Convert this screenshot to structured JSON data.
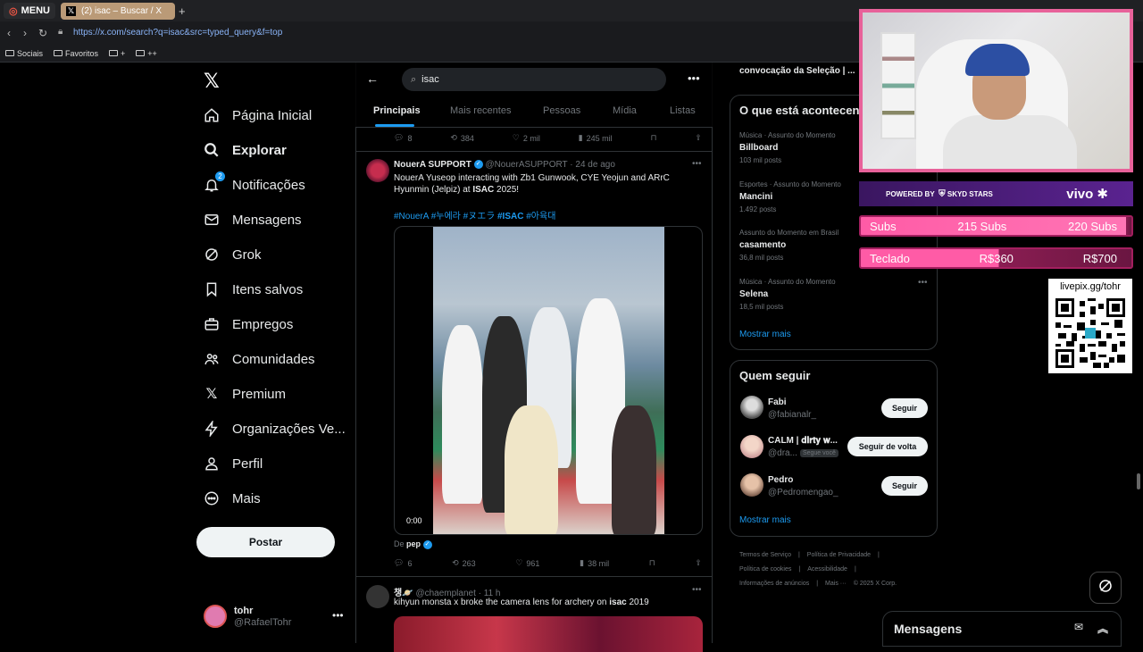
{
  "browser": {
    "menu_label": "MENU",
    "tab_title": "(2) isac – Buscar / X",
    "url": "https://x.com/search?q=isac&src=typed_query&f=top",
    "bookmarks": [
      "Sociais",
      "Favoritos",
      "+",
      "++"
    ]
  },
  "nav": {
    "items": [
      {
        "label": "Página Inicial",
        "icon": "home-icon"
      },
      {
        "label": "Explorar",
        "icon": "search-icon"
      },
      {
        "label": "Notificações",
        "icon": "bell-icon",
        "badge": "2"
      },
      {
        "label": "Mensagens",
        "icon": "mail-icon"
      },
      {
        "label": "Grok",
        "icon": "grok-icon"
      },
      {
        "label": "Itens salvos",
        "icon": "bookmark-icon"
      },
      {
        "label": "Empregos",
        "icon": "briefcase-icon"
      },
      {
        "label": "Comunidades",
        "icon": "people-icon"
      },
      {
        "label": "Premium",
        "icon": "x-icon"
      },
      {
        "label": "Organizações Ve...",
        "icon": "lightning-icon"
      },
      {
        "label": "Perfil",
        "icon": "person-icon"
      },
      {
        "label": "Mais",
        "icon": "more-circle-icon"
      }
    ],
    "post_label": "Postar",
    "user_name": "tohr",
    "user_handle": "@RafaelTohr"
  },
  "search": {
    "query": "isac",
    "tabs": [
      "Principais",
      "Mais recentes",
      "Pessoas",
      "Mídia",
      "Listas"
    ]
  },
  "prev_actions": {
    "replies": "8",
    "reposts": "384",
    "likes": "2 mil",
    "views": "245 mil"
  },
  "tweet1": {
    "name": "NouerA SUPPORT",
    "handle": "@NouerASUPPORT",
    "time": "24 de ago",
    "text_pre": "NouerA Yuseop interacting with Zb1 Gunwook, CYE Yeojun and ARrC Hyunmin (Jelpiz) at ",
    "text_bold": "ISAC",
    "text_post": " 2025!",
    "tag1": "#NouerA",
    "tag2": "#누에라",
    "tag3": "#ヌエラ",
    "tag4": "#ISAC",
    "tag5": "#아육대",
    "video_time": "0:00",
    "from_prefix": "De",
    "from_name": "pep",
    "replies": "6",
    "reposts": "263",
    "likes": "961",
    "views": "38 mil"
  },
  "tweet2": {
    "name": "챙🪐",
    "handle": "@chaemplanet",
    "time": "11 h",
    "text_pre": "kihyun monsta x broke the camera lens for archery on ",
    "text_bold": "isac",
    "text_post": " 2019"
  },
  "trends": {
    "top_item": "convocação da Seleção | ...",
    "title": "O que está acontecendo",
    "items": [
      {
        "meta": "Música · Assunto do Momento",
        "name": "Billboard",
        "count": "103 mil posts"
      },
      {
        "meta": "Esportes · Assunto do Momento",
        "name": "Mancini",
        "count": "1.492 posts"
      },
      {
        "meta": "Assunto do Momento em Brasil",
        "name": "casamento",
        "count": "36,8 mil posts"
      },
      {
        "meta": "Música · Assunto do Momento",
        "name": "Selena",
        "count": "18,5 mil posts"
      }
    ],
    "show_more": "Mostrar mais"
  },
  "follow": {
    "title": "Quem seguir",
    "users": [
      {
        "name": "Fabi",
        "handle": "@fabianalr_",
        "button": "Seguir"
      },
      {
        "name": "CALM | 𝐝𝐢𝐫𝐭𝐲 𝐰...",
        "handle": "@dra...",
        "follows_you": "Segue você",
        "button": "Seguir de volta"
      },
      {
        "name": "Pedro",
        "handle": "@Pedromengao_",
        "button": "Seguir"
      }
    ],
    "show_more": "Mostrar mais"
  },
  "footer": {
    "links": [
      "Termos de Serviço",
      "|",
      "Política de Privacidade",
      "|",
      "Política de cookies",
      "|",
      "Acessibilidade",
      "|",
      "Informações de anúncios",
      "|",
      "Mais ···",
      "© 2025 X Corp."
    ]
  },
  "overlay": {
    "powered_by": "POWERED BY",
    "sponsor1": "SKYD STARS",
    "sponsor2": "vivo",
    "goal1_label": "Subs",
    "goal1_current": "215 Subs",
    "goal1_target": "220 Subs",
    "goal1_progress": 0.977,
    "goal2_label": "Teclado",
    "goal2_current": "R$360",
    "goal2_target": "R$700",
    "goal2_progress": 0.514,
    "qr_label": "livepix.gg/tohr"
  },
  "messages": {
    "label": "Mensagens"
  },
  "colors": {
    "accent": "#1d9bf0",
    "overlay_pink": "#ff5ba6",
    "overlay_purple": "#5a2390"
  }
}
